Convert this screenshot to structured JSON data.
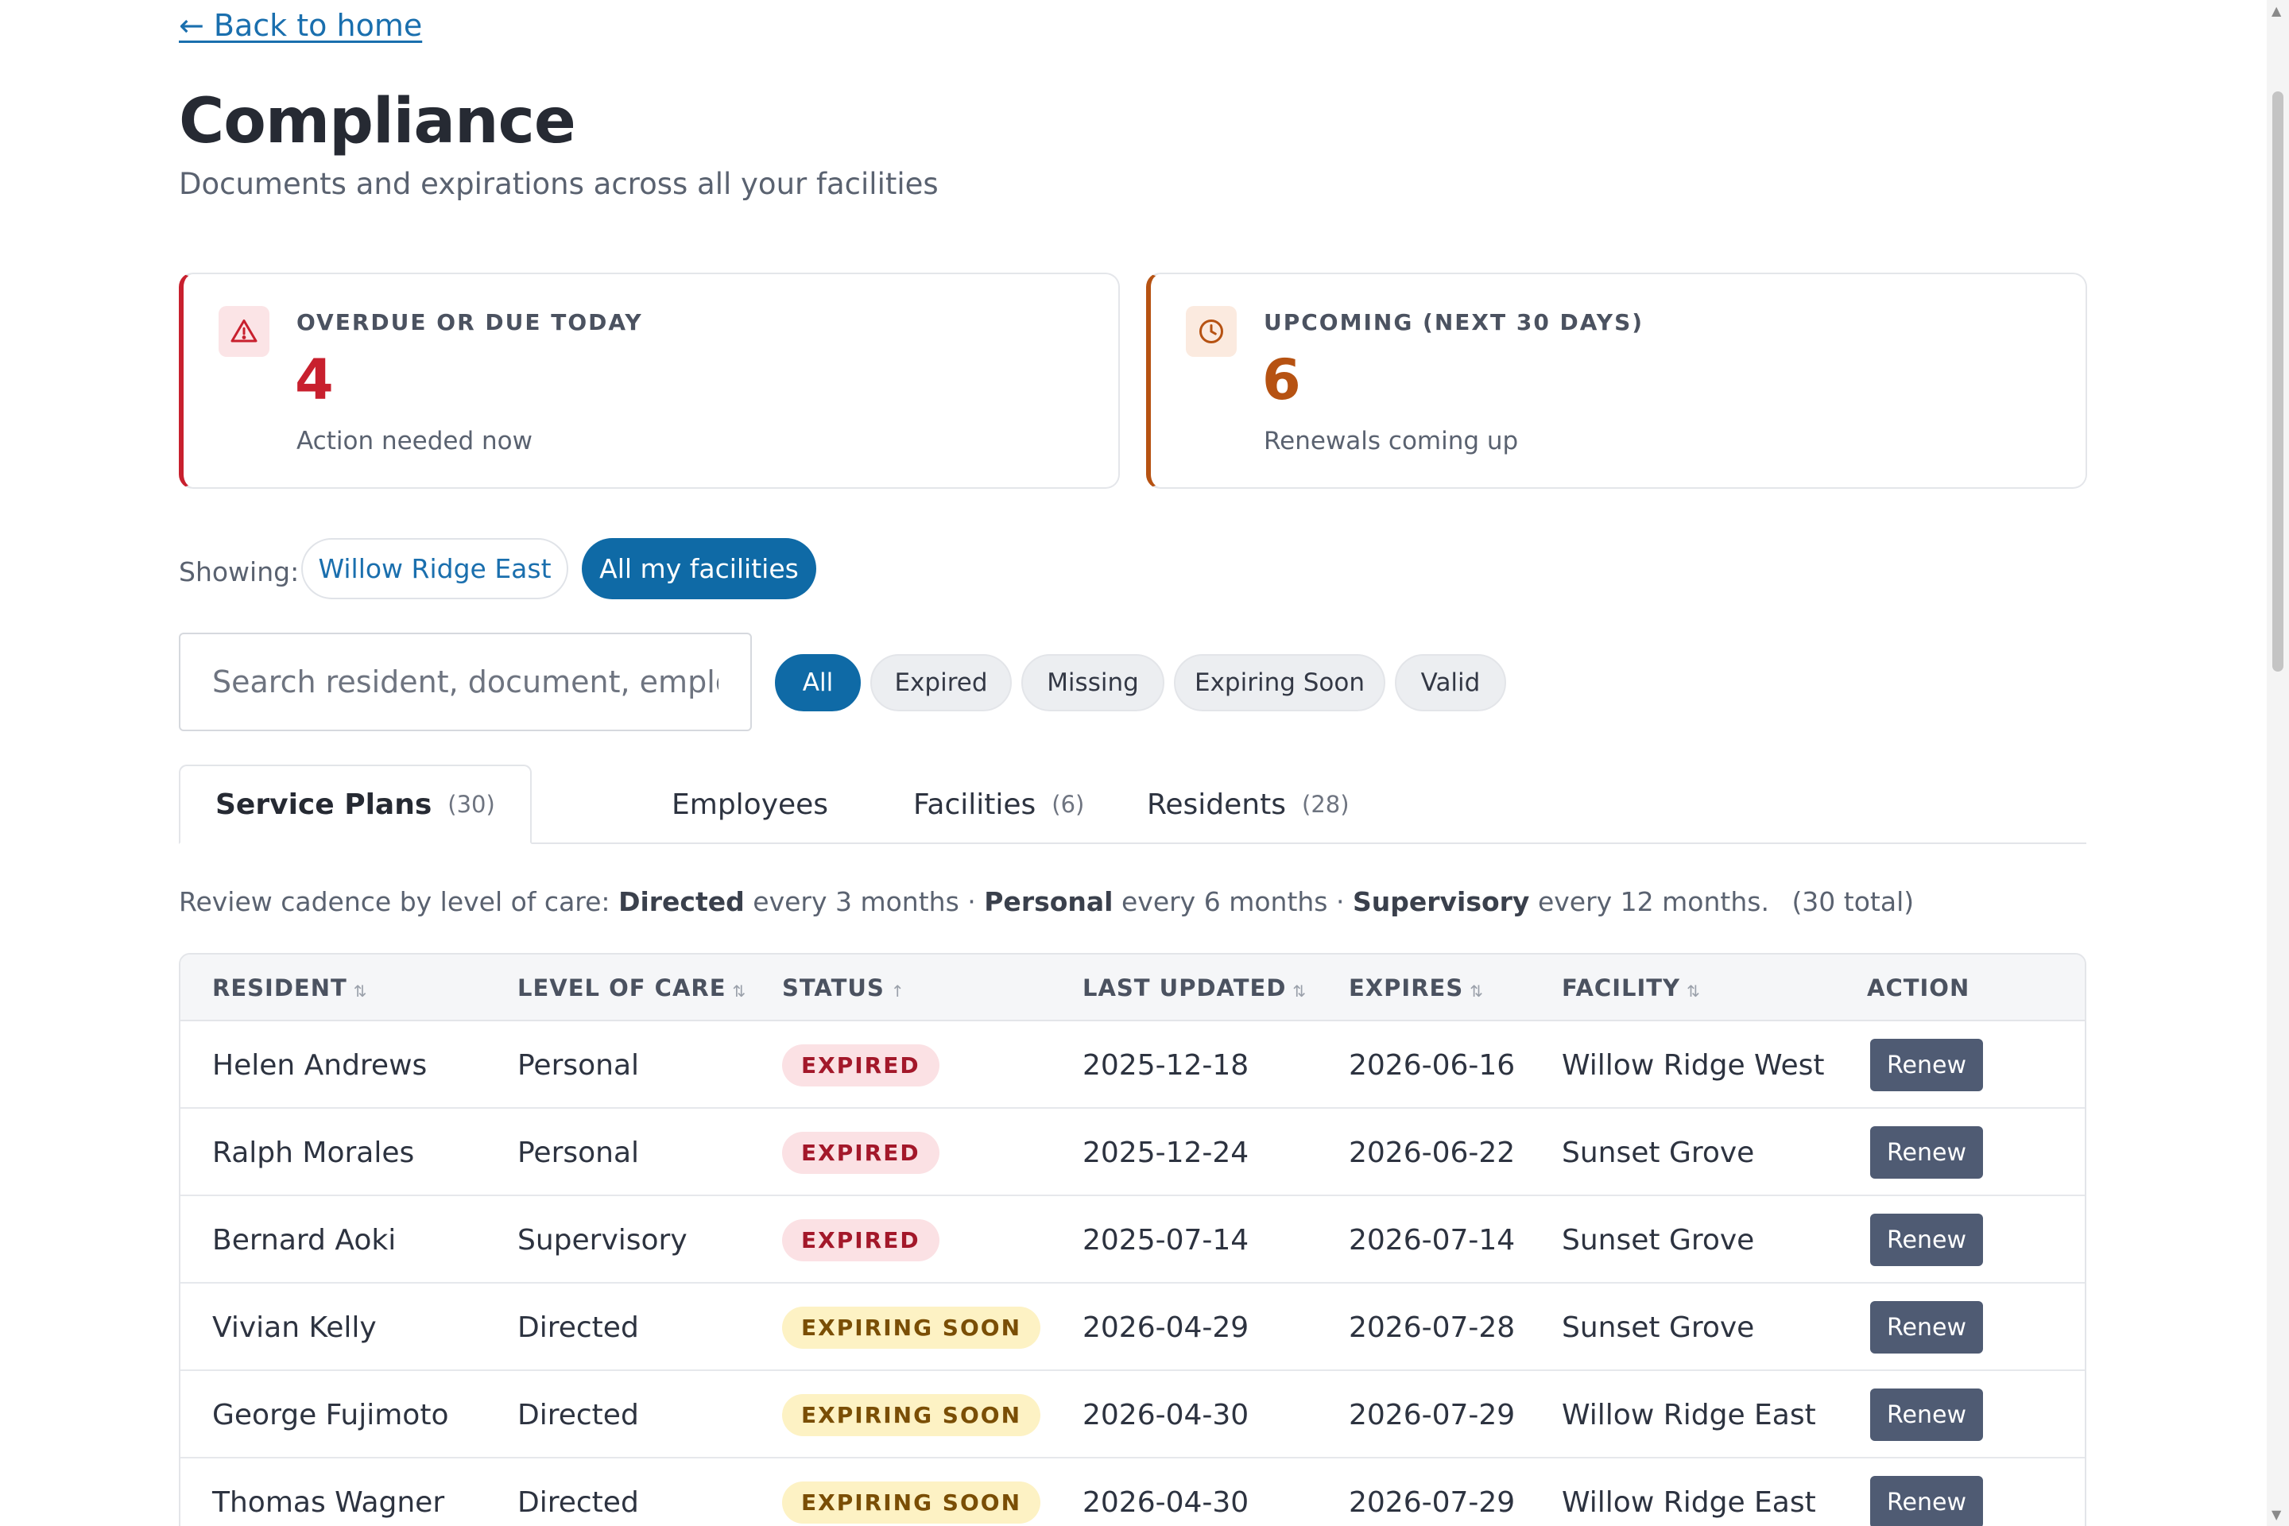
{
  "nav": {
    "back_label": "← Back to home"
  },
  "header": {
    "title": "Compliance",
    "subtitle": "Documents and expirations across all your facilities"
  },
  "summary": {
    "overdue": {
      "label": "OVERDUE OR DUE TODAY",
      "count": "4",
      "note": "Action needed now",
      "icon": "warning-triangle-icon",
      "color": "#c8202e"
    },
    "upcoming": {
      "label": "UPCOMING (NEXT 30 DAYS)",
      "count": "6",
      "note": "Renewals coming up",
      "icon": "clock-icon",
      "color": "#b65212"
    }
  },
  "scope": {
    "label": "Showing:",
    "options": [
      "Willow Ridge East",
      "All my facilities"
    ],
    "selected": "All my facilities"
  },
  "search": {
    "placeholder": "Search resident, document, employee…",
    "value": ""
  },
  "status_filters": {
    "options": [
      "All",
      "Expired",
      "Missing",
      "Expiring Soon",
      "Valid"
    ],
    "selected": "All"
  },
  "tabs": [
    {
      "label": "Service Plans",
      "count": "(30)"
    },
    {
      "label": "Employees",
      "count": ""
    },
    {
      "label": "Facilities",
      "count": "(6)"
    },
    {
      "label": "Residents",
      "count": "(28)"
    }
  ],
  "cadence": {
    "prefix": "Review cadence by level of care:",
    "directed": "Directed",
    "directed_period": "every 3 months ·",
    "personal": "Personal",
    "personal_period": "every 6 months ·",
    "supervisory": "Supervisory",
    "supervisory_period": "every 12 months.",
    "total": "(30 total)"
  },
  "table": {
    "headers": {
      "resident": "RESIDENT",
      "level": "LEVEL OF CARE",
      "status": "STATUS",
      "updated": "LAST UPDATED",
      "expires": "EXPIRES",
      "facility": "FACILITY",
      "action": "ACTION"
    },
    "sort_icons": {
      "unsorted": "⇅",
      "ascending": "↑"
    },
    "rows": [
      {
        "resident": "Helen Andrews",
        "level": "Personal",
        "status": "EXPIRED",
        "updated": "2025-12-18",
        "expires": "2026-06-16",
        "facility": "Willow Ridge West",
        "action": "Renew"
      },
      {
        "resident": "Ralph Morales",
        "level": "Personal",
        "status": "EXPIRED",
        "updated": "2025-12-24",
        "expires": "2026-06-22",
        "facility": "Sunset Grove",
        "action": "Renew"
      },
      {
        "resident": "Bernard Aoki",
        "level": "Supervisory",
        "status": "EXPIRED",
        "updated": "2025-07-14",
        "expires": "2026-07-14",
        "facility": "Sunset Grove",
        "action": "Renew"
      },
      {
        "resident": "Vivian Kelly",
        "level": "Directed",
        "status": "EXPIRING SOON",
        "updated": "2026-04-29",
        "expires": "2026-07-28",
        "facility": "Sunset Grove",
        "action": "Renew"
      },
      {
        "resident": "George Fujimoto",
        "level": "Directed",
        "status": "EXPIRING SOON",
        "updated": "2026-04-30",
        "expires": "2026-07-29",
        "facility": "Willow Ridge East",
        "action": "Renew"
      },
      {
        "resident": "Thomas Wagner",
        "level": "Directed",
        "status": "EXPIRING SOON",
        "updated": "2026-04-30",
        "expires": "2026-07-29",
        "facility": "Willow Ridge East",
        "action": "Renew"
      }
    ]
  },
  "colors": {
    "accent": "#0f6aa6",
    "danger": "#c8202e",
    "warning": "#b65212",
    "button": "#4f5b73"
  }
}
